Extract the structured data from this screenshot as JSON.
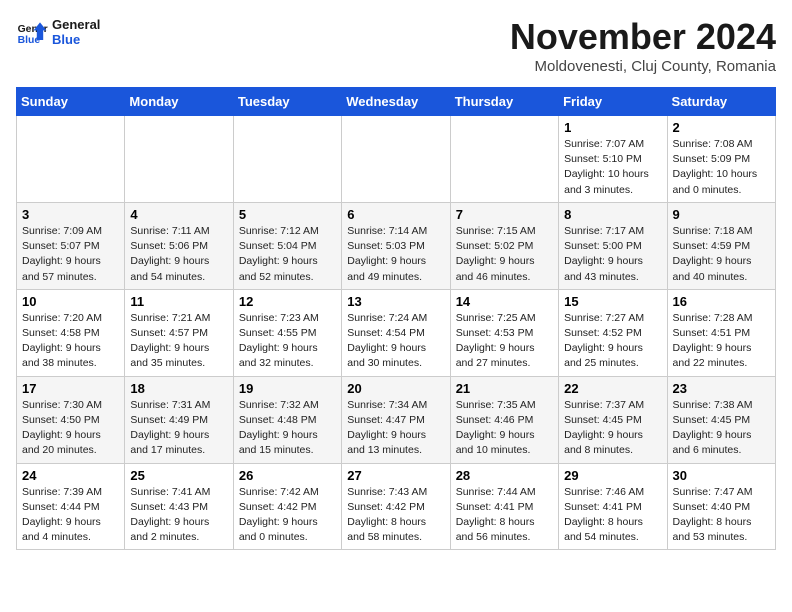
{
  "header": {
    "logo_general": "General",
    "logo_blue": "Blue",
    "month_title": "November 2024",
    "location": "Moldovenesti, Cluj County, Romania"
  },
  "days_of_week": [
    "Sunday",
    "Monday",
    "Tuesday",
    "Wednesday",
    "Thursday",
    "Friday",
    "Saturday"
  ],
  "weeks": [
    {
      "days": [
        {
          "num": "",
          "info": ""
        },
        {
          "num": "",
          "info": ""
        },
        {
          "num": "",
          "info": ""
        },
        {
          "num": "",
          "info": ""
        },
        {
          "num": "",
          "info": ""
        },
        {
          "num": "1",
          "info": "Sunrise: 7:07 AM\nSunset: 5:10 PM\nDaylight: 10 hours\nand 3 minutes."
        },
        {
          "num": "2",
          "info": "Sunrise: 7:08 AM\nSunset: 5:09 PM\nDaylight: 10 hours\nand 0 minutes."
        }
      ]
    },
    {
      "days": [
        {
          "num": "3",
          "info": "Sunrise: 7:09 AM\nSunset: 5:07 PM\nDaylight: 9 hours\nand 57 minutes."
        },
        {
          "num": "4",
          "info": "Sunrise: 7:11 AM\nSunset: 5:06 PM\nDaylight: 9 hours\nand 54 minutes."
        },
        {
          "num": "5",
          "info": "Sunrise: 7:12 AM\nSunset: 5:04 PM\nDaylight: 9 hours\nand 52 minutes."
        },
        {
          "num": "6",
          "info": "Sunrise: 7:14 AM\nSunset: 5:03 PM\nDaylight: 9 hours\nand 49 minutes."
        },
        {
          "num": "7",
          "info": "Sunrise: 7:15 AM\nSunset: 5:02 PM\nDaylight: 9 hours\nand 46 minutes."
        },
        {
          "num": "8",
          "info": "Sunrise: 7:17 AM\nSunset: 5:00 PM\nDaylight: 9 hours\nand 43 minutes."
        },
        {
          "num": "9",
          "info": "Sunrise: 7:18 AM\nSunset: 4:59 PM\nDaylight: 9 hours\nand 40 minutes."
        }
      ]
    },
    {
      "days": [
        {
          "num": "10",
          "info": "Sunrise: 7:20 AM\nSunset: 4:58 PM\nDaylight: 9 hours\nand 38 minutes."
        },
        {
          "num": "11",
          "info": "Sunrise: 7:21 AM\nSunset: 4:57 PM\nDaylight: 9 hours\nand 35 minutes."
        },
        {
          "num": "12",
          "info": "Sunrise: 7:23 AM\nSunset: 4:55 PM\nDaylight: 9 hours\nand 32 minutes."
        },
        {
          "num": "13",
          "info": "Sunrise: 7:24 AM\nSunset: 4:54 PM\nDaylight: 9 hours\nand 30 minutes."
        },
        {
          "num": "14",
          "info": "Sunrise: 7:25 AM\nSunset: 4:53 PM\nDaylight: 9 hours\nand 27 minutes."
        },
        {
          "num": "15",
          "info": "Sunrise: 7:27 AM\nSunset: 4:52 PM\nDaylight: 9 hours\nand 25 minutes."
        },
        {
          "num": "16",
          "info": "Sunrise: 7:28 AM\nSunset: 4:51 PM\nDaylight: 9 hours\nand 22 minutes."
        }
      ]
    },
    {
      "days": [
        {
          "num": "17",
          "info": "Sunrise: 7:30 AM\nSunset: 4:50 PM\nDaylight: 9 hours\nand 20 minutes."
        },
        {
          "num": "18",
          "info": "Sunrise: 7:31 AM\nSunset: 4:49 PM\nDaylight: 9 hours\nand 17 minutes."
        },
        {
          "num": "19",
          "info": "Sunrise: 7:32 AM\nSunset: 4:48 PM\nDaylight: 9 hours\nand 15 minutes."
        },
        {
          "num": "20",
          "info": "Sunrise: 7:34 AM\nSunset: 4:47 PM\nDaylight: 9 hours\nand 13 minutes."
        },
        {
          "num": "21",
          "info": "Sunrise: 7:35 AM\nSunset: 4:46 PM\nDaylight: 9 hours\nand 10 minutes."
        },
        {
          "num": "22",
          "info": "Sunrise: 7:37 AM\nSunset: 4:45 PM\nDaylight: 9 hours\nand 8 minutes."
        },
        {
          "num": "23",
          "info": "Sunrise: 7:38 AM\nSunset: 4:45 PM\nDaylight: 9 hours\nand 6 minutes."
        }
      ]
    },
    {
      "days": [
        {
          "num": "24",
          "info": "Sunrise: 7:39 AM\nSunset: 4:44 PM\nDaylight: 9 hours\nand 4 minutes."
        },
        {
          "num": "25",
          "info": "Sunrise: 7:41 AM\nSunset: 4:43 PM\nDaylight: 9 hours\nand 2 minutes."
        },
        {
          "num": "26",
          "info": "Sunrise: 7:42 AM\nSunset: 4:42 PM\nDaylight: 9 hours\nand 0 minutes."
        },
        {
          "num": "27",
          "info": "Sunrise: 7:43 AM\nSunset: 4:42 PM\nDaylight: 8 hours\nand 58 minutes."
        },
        {
          "num": "28",
          "info": "Sunrise: 7:44 AM\nSunset: 4:41 PM\nDaylight: 8 hours\nand 56 minutes."
        },
        {
          "num": "29",
          "info": "Sunrise: 7:46 AM\nSunset: 4:41 PM\nDaylight: 8 hours\nand 54 minutes."
        },
        {
          "num": "30",
          "info": "Sunrise: 7:47 AM\nSunset: 4:40 PM\nDaylight: 8 hours\nand 53 minutes."
        }
      ]
    }
  ]
}
